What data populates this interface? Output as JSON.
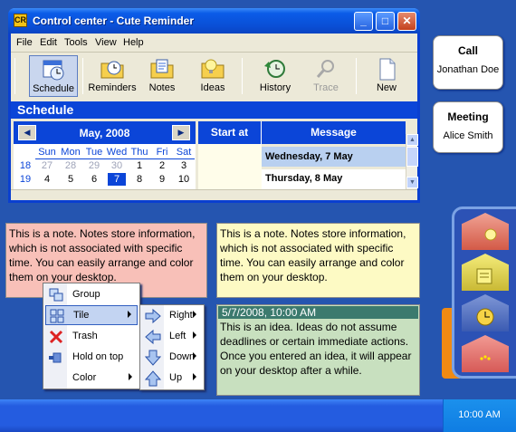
{
  "window": {
    "app_icon_text": "CR",
    "title": "Control center - Cute Reminder",
    "minimize": "_",
    "maximize": "□",
    "close": "✕"
  },
  "menu": [
    "File",
    "Edit",
    "Tools",
    "View",
    "Help"
  ],
  "toolbar": {
    "schedule": "Schedule",
    "reminders": "Reminders",
    "notes": "Notes",
    "ideas": "Ideas",
    "history": "History",
    "trace": "Trace",
    "new": "New"
  },
  "schedule": {
    "header": "Schedule",
    "month": "May, 2008",
    "weekdays": [
      "Sun",
      "Mon",
      "Tue",
      "Wed",
      "Thu",
      "Fri",
      "Sat"
    ],
    "weeks": [
      {
        "num": "18",
        "days": [
          "27",
          "28",
          "29",
          "30",
          "1",
          "2",
          "3"
        ]
      },
      {
        "num": "19",
        "days": [
          "4",
          "5",
          "6",
          "7",
          "8",
          "9",
          "10"
        ]
      }
    ],
    "columns": {
      "start": "Start at",
      "message": "Message"
    },
    "rows": [
      "Wednesday, 7 May",
      "Thursday, 8 May"
    ]
  },
  "contacts": [
    {
      "type": "Call",
      "name": "Jonathan Doe"
    },
    {
      "type": "Meeting",
      "name": "Alice Smith"
    }
  ],
  "notes": {
    "pink": "This is a note. Notes store information, which is not associated with specific time. You can easily arrange and color them on your desktop.",
    "yellow": "This is a note. Notes store information, which is not associated with specific time. You can easily arrange and color them on your desktop."
  },
  "idea": {
    "date": "5/7/2008, 10:00 AM",
    "text": "This is an idea. Ideas do not assume deadlines or certain immediate actions. Once you entered an idea, it will appear on your desktop after a while."
  },
  "context_menu": [
    "Group",
    "Tile",
    "Trash",
    "Hold on top",
    "Color"
  ],
  "submenu": [
    "Right",
    "Left",
    "Down",
    "Up"
  ],
  "taskbar": {
    "clock": "10:00 AM"
  },
  "colors": {
    "desktop": "#2555b0",
    "note_pink": "#f8c0b8",
    "note_yellow": "#fdfac4",
    "idea_bg": "#c8e0bf",
    "accent_blue": "#0b45d8"
  }
}
